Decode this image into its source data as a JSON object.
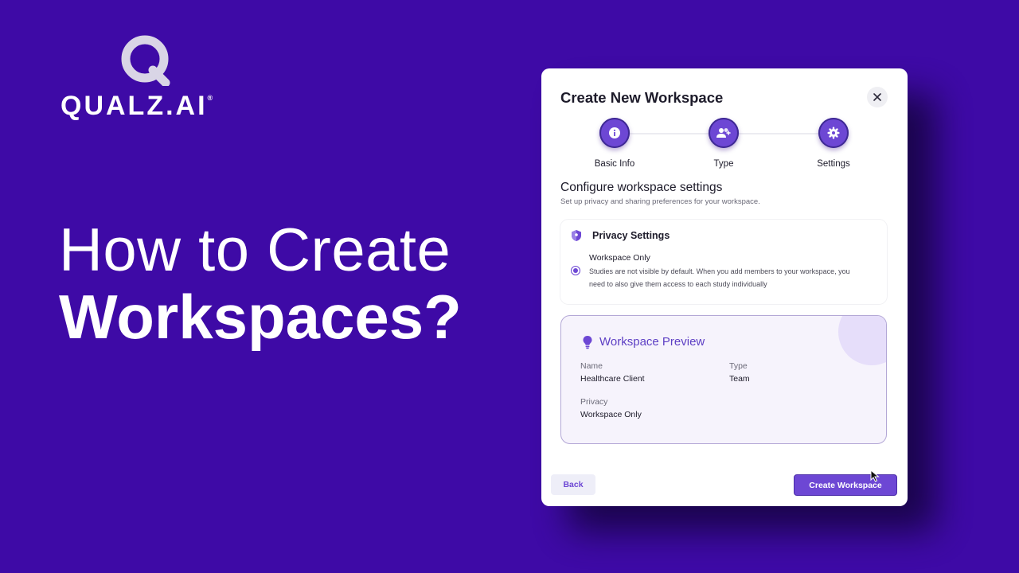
{
  "brand": {
    "name": "QUALZ.AI",
    "trademark": "®",
    "logo_icon": "q-sparkle-icon"
  },
  "headline": {
    "line1": "How to Create",
    "line2": "Workspaces?"
  },
  "modal": {
    "title": "Create New Workspace",
    "close_icon": "close-icon",
    "steps": [
      {
        "label": "Basic Info",
        "icon": "info-icon"
      },
      {
        "label": "Type",
        "icon": "users-icon"
      },
      {
        "label": "Settings",
        "icon": "gear-icon"
      }
    ],
    "section_title": "Configure workspace settings",
    "section_subtitle": "Set up privacy and sharing preferences for your workspace.",
    "privacy": {
      "title": "Privacy Settings",
      "icon": "shield-icon",
      "option_title": "Workspace Only",
      "option_desc": "Studies are not visible by default. When you add members to your workspace, you need to also give them access to each study individually",
      "selected": true
    },
    "preview": {
      "title": "Workspace Preview",
      "icon": "lightbulb-icon",
      "name_label": "Name",
      "name_value": "Healthcare Client",
      "type_label": "Type",
      "type_value": "Team",
      "privacy_label": "Privacy",
      "privacy_value": "Workspace Only"
    },
    "back_label": "Back",
    "create_label": "Create Workspace"
  },
  "colors": {
    "background": "#3e0aa6",
    "accent": "#6d47d4"
  }
}
